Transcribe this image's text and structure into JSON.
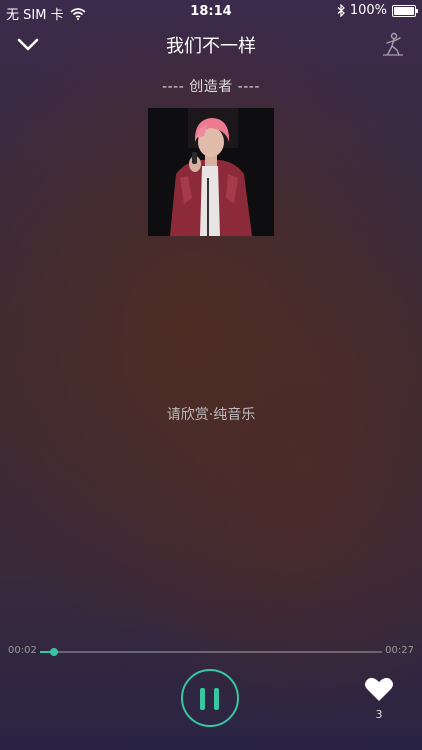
{
  "status": {
    "carrier": "无 SIM 卡",
    "time": "18:14",
    "battery": "100%",
    "battery_level": 1.0,
    "icons": [
      "wifi-icon",
      "bluetooth-icon",
      "battery-icon"
    ]
  },
  "nav": {
    "title": "我们不一样",
    "back_icon": "chevron-down-icon",
    "right_icon": "singer-figure-icon"
  },
  "song": {
    "subtitle": "---- 创造者 ----",
    "lyric": "请欣赏·纯音乐"
  },
  "player": {
    "current_time": "00:02",
    "duration": "00:27",
    "progress": 0.04,
    "state_icon": "pause-icon",
    "like_icon": "heart-icon",
    "like_count": "3"
  },
  "colors": {
    "accent": "#37c6a0"
  }
}
